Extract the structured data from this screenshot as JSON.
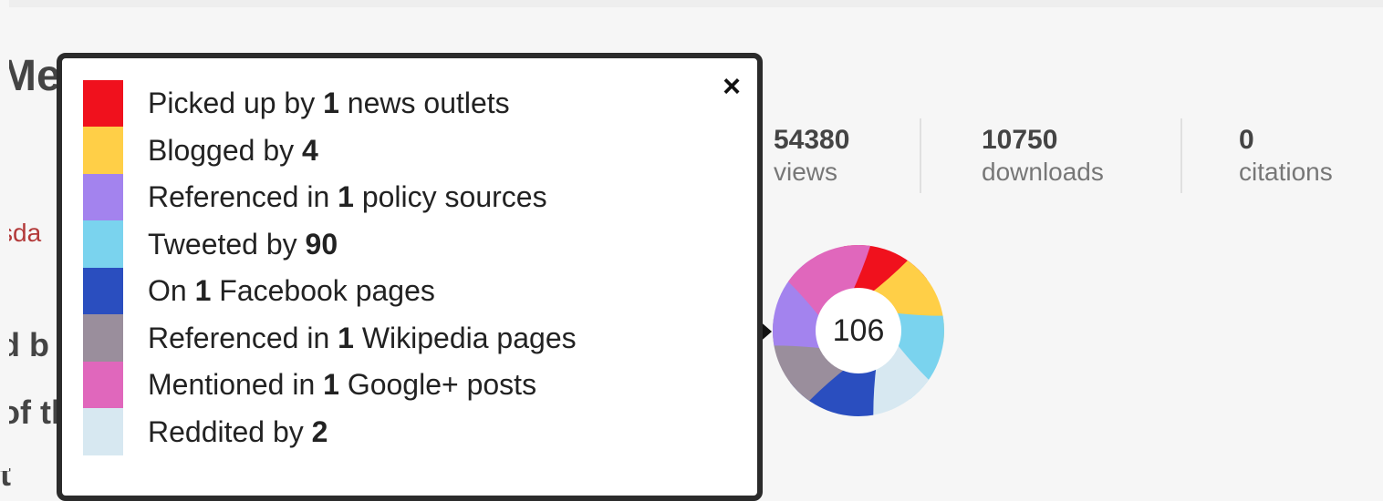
{
  "background": {
    "title_fragment": "Me",
    "red_fragment": "sda",
    "bold_fragments": [
      "d b",
      "of th",
      "t"
    ]
  },
  "stats": [
    {
      "value": "54380",
      "label": "views"
    },
    {
      "value": "10750",
      "label": "downloads"
    },
    {
      "value": "0",
      "label": "citations"
    }
  ],
  "altmetric": {
    "score": "106",
    "close_label": "×",
    "items": [
      {
        "prefix": "Picked up by ",
        "count": "1",
        "suffix": " news outlets",
        "color": "#f0111d",
        "icon": "news-swatch"
      },
      {
        "prefix": "Blogged by ",
        "count": "4",
        "suffix": "",
        "color": "#ffcf47",
        "icon": "blog-swatch"
      },
      {
        "prefix": "Referenced in ",
        "count": "1",
        "suffix": " policy sources",
        "color": "#a383ee",
        "icon": "policy-swatch"
      },
      {
        "prefix": "Tweeted by ",
        "count": "90",
        "suffix": "",
        "color": "#7ad3ee",
        "icon": "twitter-swatch"
      },
      {
        "prefix": "On ",
        "count": "1",
        "suffix": " Facebook pages",
        "color": "#2a4ebf",
        "icon": "facebook-swatch"
      },
      {
        "prefix": "Referenced in ",
        "count": "1",
        "suffix": " Wikipedia pages",
        "color": "#9a8e9c",
        "icon": "wikipedia-swatch"
      },
      {
        "prefix": "Mentioned in ",
        "count": "1",
        "suffix": " Google+ posts",
        "color": "#e067bc",
        "icon": "googleplus-swatch"
      },
      {
        "prefix": "Reddited by ",
        "count": "2",
        "suffix": "",
        "color": "#d7e8f1",
        "icon": "reddit-swatch"
      }
    ]
  }
}
